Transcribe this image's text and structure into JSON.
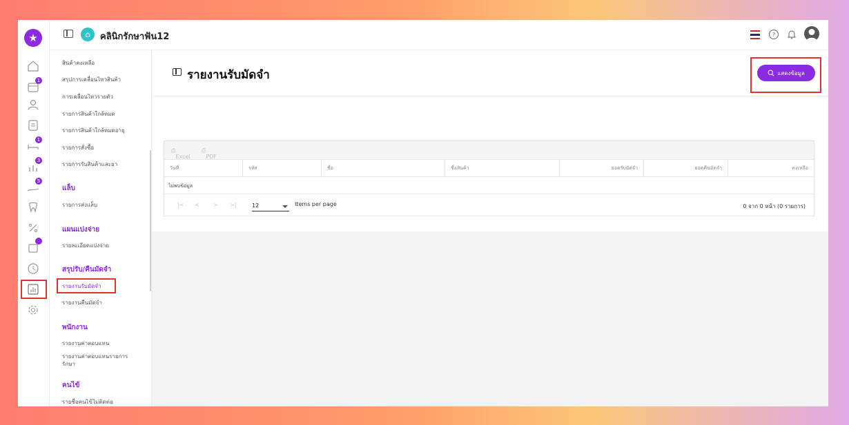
{
  "app": {
    "clinic_name": "คลินิกรักษาฟัน12",
    "brand_color": "#8a2be2"
  },
  "rail": {
    "items": [
      {
        "icon": "home-icon",
        "badge": ""
      },
      {
        "icon": "calendar-icon",
        "badge": "1"
      },
      {
        "icon": "user-icon",
        "badge": ""
      },
      {
        "icon": "document-icon",
        "badge": ""
      },
      {
        "icon": "bed-icon",
        "badge": "1"
      },
      {
        "icon": "chart-people-icon",
        "badge": "3"
      },
      {
        "icon": "money-hand-icon",
        "badge": "5"
      },
      {
        "icon": "tooth-icon",
        "badge": ""
      },
      {
        "icon": "percent-icon",
        "badge": ""
      },
      {
        "icon": "box-icon",
        "badge": ""
      },
      {
        "icon": "clock-icon",
        "badge": ""
      },
      {
        "icon": "report-icon",
        "badge": ""
      },
      {
        "icon": "gear-icon",
        "badge": ""
      }
    ]
  },
  "submenu": {
    "items": [
      {
        "label": "สินค้าคงเหลือ"
      },
      {
        "label": "สรุปการเคลื่อนไหวสินค้า"
      },
      {
        "label": "การเคลื่อนไหวรายตัว"
      },
      {
        "label": "รายการสินค้าใกล้หมด"
      },
      {
        "label": "รายการสินค้าใกล้หมดอายุ"
      },
      {
        "label": "รายการสั่งซื้อ"
      },
      {
        "label": "รายการรับสินค้าและยา"
      }
    ],
    "lab_header": "แล็บ",
    "lab_items": [
      "รายการส่งแล็บ"
    ],
    "split_header": "แผนแบ่งจ่าย",
    "split_items": [
      "รายละเอียดแบ่งจ่าย"
    ],
    "deposit_header": "สรุปรับ/คืนมัดจำ",
    "deposit_items": [
      "รายงานรับมัดจำ",
      "รายงานคืนมัดจำ"
    ],
    "staff_header": "พนักงาน",
    "staff_items": [
      "รายงานค่าตอบแทน",
      "รายงานค่าตอบแทนรายการ",
      "รักษา"
    ],
    "patient_header": "คนไข้",
    "patient_items": [
      "รายชื่อคนไข้ไม่ติดต่อ"
    ]
  },
  "page": {
    "title": "รายงานรับมัดจำ",
    "show_button": "แสดงข้อมูล"
  },
  "table": {
    "exports": [
      "Excel",
      "PDF"
    ],
    "columns": [
      "วันที่",
      "รหัส",
      "ชื่อ",
      "ชื่อสินค้า",
      "ยอดรับมัดจำ",
      "ยอดคืนมัดจำ",
      "คงเหลือ"
    ],
    "empty_text": "ไม่พบข้อมูล"
  },
  "pager": {
    "page_size": "12",
    "items_per_page": "Items per page",
    "range": "0 จาก 0 หน้า (0 รายการ)"
  }
}
